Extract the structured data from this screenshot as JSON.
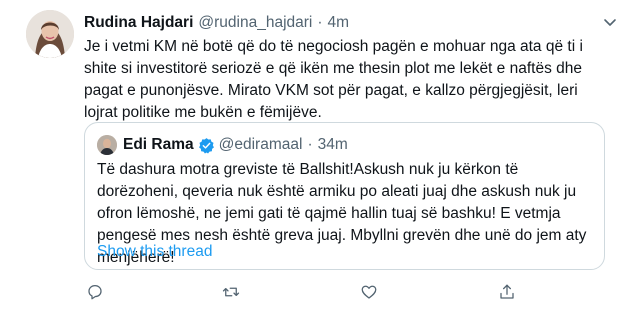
{
  "tweet": {
    "author_name": "Rudina Hajdari",
    "author_handle": "@rudina_hajdari",
    "separator": "·",
    "time": "4m",
    "text": "Je i vetmi KM në botë që do të negociosh pagën e mohuar nga ata që ti i shite si investitorë seriozë e që ikën me thesin plot me lekët e naftës dhe pagat e punonjësve. Mirato VKM sot për pagat, e kallzo përgjegjësit, leri lojrat politike me bukën e fëmijëve.",
    "quote": {
      "author_name": "Edi Rama",
      "author_handle": "@ediramaal",
      "separator": "·",
      "time": "34m",
      "text": "Të dashura motra greviste të Ballshit!Askush nuk ju kërkon të dorëzoheni, qeveria nuk është armiku po aleati juaj dhe askush nuk ju ofron lëmoshë, ne jemi gati të qajmë hallin tuaj së bashku! E vetmja pengesë mes nesh është greva juaj. Mbyllni grevën dhe unë do jem aty menjëherë!",
      "show_thread": "Show this thread"
    }
  },
  "icons": {
    "accent_color": "#1d9bf0",
    "muted_color": "#536471",
    "border_color": "#cfd9de"
  }
}
